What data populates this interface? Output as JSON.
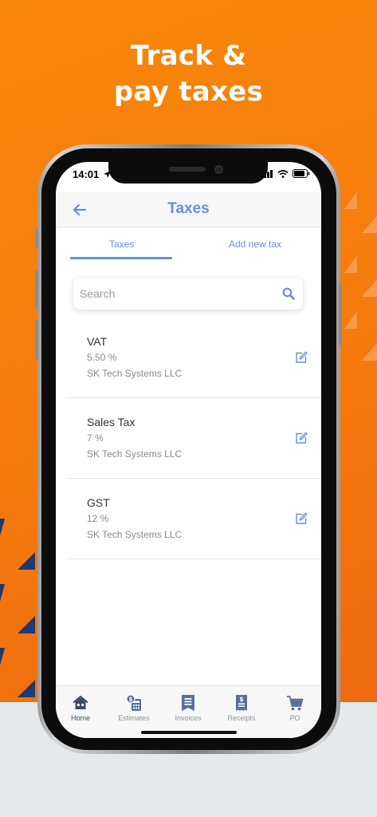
{
  "headline": {
    "line1": "Track &",
    "line2": "pay taxes"
  },
  "status_bar": {
    "time": "14:01"
  },
  "nav": {
    "title": "Taxes"
  },
  "tabs": [
    {
      "label": "Taxes",
      "active": true
    },
    {
      "label": "Add new tax",
      "active": false
    }
  ],
  "search": {
    "placeholder": "Search",
    "value": ""
  },
  "taxes": [
    {
      "name": "VAT",
      "rate": "5.50 %",
      "company": "SK Tech Systems LLC"
    },
    {
      "name": "Sales Tax",
      "rate": "7 %",
      "company": "SK Tech Systems LLC"
    },
    {
      "name": "GST",
      "rate": "12 %",
      "company": "SK Tech Systems LLC"
    }
  ],
  "bottom_nav": [
    {
      "label": "Home",
      "icon": "home-icon",
      "active": true
    },
    {
      "label": "Estimates",
      "icon": "estimates-icon",
      "active": false
    },
    {
      "label": "Invoices",
      "icon": "invoices-icon",
      "active": false
    },
    {
      "label": "Receipts",
      "icon": "receipts-icon",
      "active": false
    },
    {
      "label": "PO",
      "icon": "cart-icon",
      "active": false
    }
  ],
  "colors": {
    "brand_orange": "#f57b0c",
    "accent_blue": "#6a8fd5",
    "deco_navy": "#1e3a6e",
    "icon_slate": "#5b6f95"
  }
}
